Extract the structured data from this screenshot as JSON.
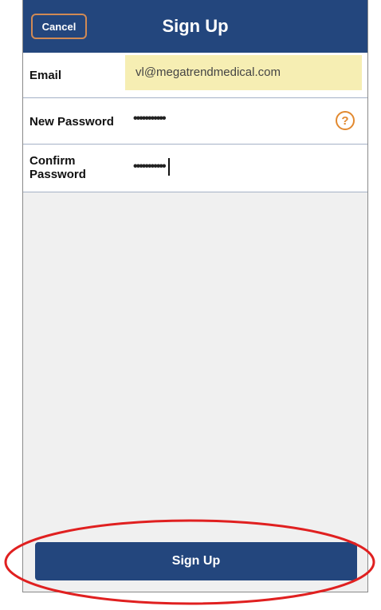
{
  "header": {
    "cancel_label": "Cancel",
    "title": "Sign Up"
  },
  "form": {
    "email": {
      "label": "Email",
      "value": "vl@megatrendmedical.com"
    },
    "new_password": {
      "label": "New Password",
      "value": "•••••••••••",
      "help_icon": "question-circle-icon",
      "help_glyph": "?"
    },
    "confirm_password": {
      "label_line1": "Confirm",
      "label_line2": "Password",
      "value": "•••••••••••"
    }
  },
  "footer": {
    "signup_label": "Sign Up"
  },
  "colors": {
    "header_bg": "#23467d",
    "cancel_border": "#d08a55",
    "email_field_bg": "#f6eeb3",
    "help_icon": "#e2892f",
    "annotation": "#e02020"
  }
}
